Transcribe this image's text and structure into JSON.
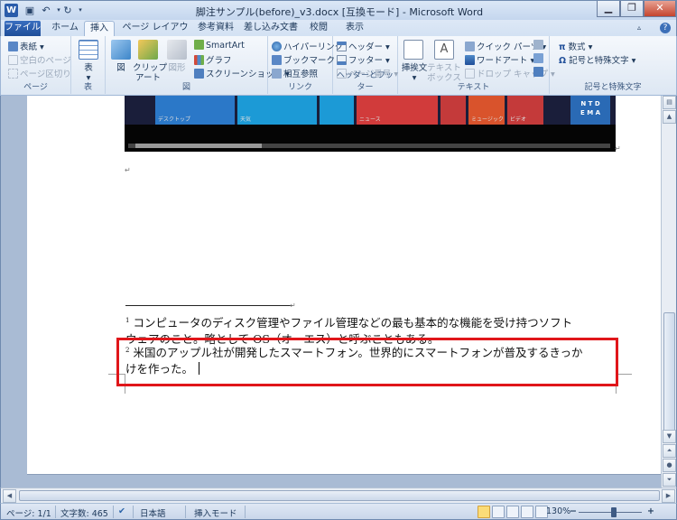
{
  "window": {
    "title": "脚注サンプル(before)_v3.docx [互換モード] - Microsoft Word",
    "app_icon": "W",
    "controls": [
      "minimize-icon",
      "restore-icon",
      "close-icon"
    ]
  },
  "qat": {
    "save_icon": "save-icon",
    "undo_icon": "undo-icon",
    "redo_icon": "redo-icon",
    "customize_icon": "chevron-down-icon"
  },
  "tabs": [
    {
      "label": "ファイル"
    },
    {
      "label": "ホーム"
    },
    {
      "label": "挿入"
    },
    {
      "label": "ページ レイアウト"
    },
    {
      "label": "参考資料"
    },
    {
      "label": "差し込み文書"
    },
    {
      "label": "校閲"
    },
    {
      "label": "表示"
    }
  ],
  "active_tab": "挿入",
  "ribbon": {
    "pages": {
      "cover": "表紙",
      "blank": "空白のページ",
      "break": "ページ区切り",
      "label": "ページ"
    },
    "table": {
      "button": "表",
      "label": "表"
    },
    "illustrations": {
      "picture": "図",
      "clipart": "クリップ\nアート",
      "shapes": "図形",
      "smartart": "SmartArt",
      "chart": "グラフ",
      "screenshot": "スクリーンショット",
      "label": "図"
    },
    "links": {
      "hyperlink": "ハイパーリンク",
      "bookmark": "ブックマーク",
      "crossref": "相互参照",
      "label": "リンク"
    },
    "header_footer": {
      "header": "ヘッダー",
      "footer": "フッター",
      "page_number": "ページ番号",
      "label": "ヘッダーとフッター"
    },
    "text": {
      "textbox_insert": "挿挨文",
      "textbox": "テキスト\nボックス",
      "quickparts": "クイック パーツ",
      "wordart": "ワードアート",
      "dropcap": "ドロップ キャップ",
      "label": "テキスト"
    },
    "symbols": {
      "equation": "数式",
      "symbol": "記号と特殊文字",
      "label": "記号と特殊文字"
    }
  },
  "document": {
    "tiles": [
      "デスクトップ",
      "天気",
      "",
      "ニュース",
      "",
      "ミュージック",
      "ビデオ",
      ""
    ],
    "tile_grid_text": "N T D\nE M A",
    "footnotes": [
      {
        "num": "1",
        "line1": "コンピュータのディスク管理やファイル管理などの最も基本的な機能を受け持つソフト",
        "line2": "ウェアのこと。略として OS（オーエス）と呼ぶこともある。"
      },
      {
        "num": "2",
        "line1": "米国のアップル社が開発したスマートフォン。世界的にスマートフォンが普及するきっか",
        "line2": "けを作った。"
      }
    ],
    "para_mark": "↵"
  },
  "status": {
    "page": "ページ: 1/1",
    "words": "文字数: 465",
    "language": "日本語",
    "mode": "挿入モード",
    "zoom": "130%"
  },
  "colors": {
    "highlight": "#e0161a",
    "file_tab": "#2b579a"
  }
}
